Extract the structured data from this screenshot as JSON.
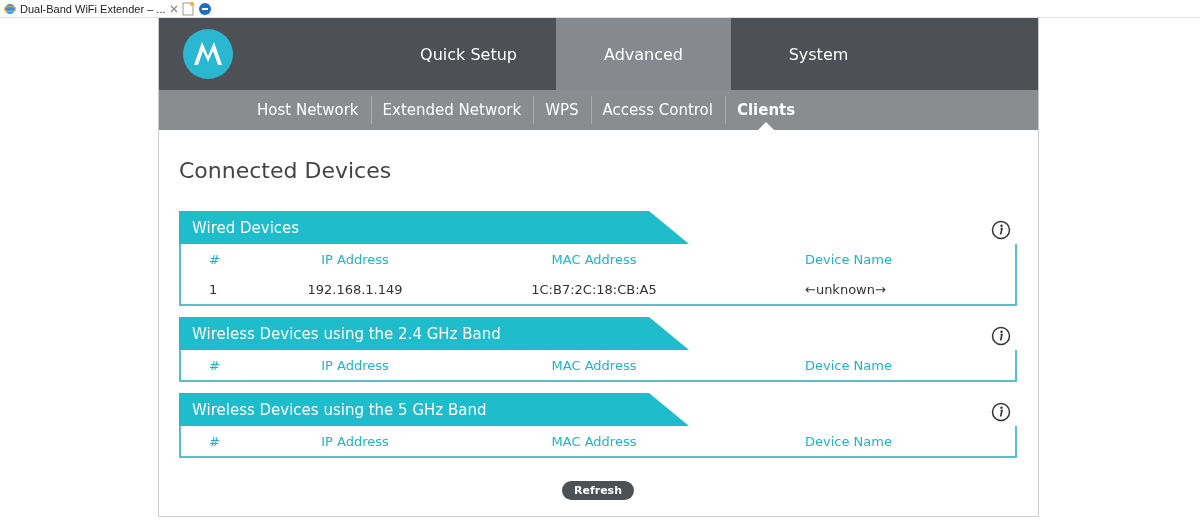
{
  "browser_tab": {
    "title": "Dual-Band WiFi Extender – ..."
  },
  "nav": {
    "tabs": [
      {
        "label": "Quick Setup",
        "selected": false
      },
      {
        "label": "Advanced",
        "selected": true
      },
      {
        "label": "System",
        "selected": false
      }
    ]
  },
  "subnav": {
    "items": [
      {
        "label": "Host Network",
        "selected": false
      },
      {
        "label": "Extended Network",
        "selected": false
      },
      {
        "label": "WPS",
        "selected": false
      },
      {
        "label": "Access Control",
        "selected": false
      },
      {
        "label": "Clients",
        "selected": true
      }
    ]
  },
  "page_title": "Connected Devices",
  "sections": [
    {
      "title": "Wired Devices",
      "columns": [
        "#",
        "IP Address",
        "MAC Address",
        "Device Name"
      ],
      "rows": [
        [
          "1",
          "192.168.1.149",
          "1C:B7:2C:18:CB:A5",
          "←unknown→"
        ]
      ]
    },
    {
      "title": "Wireless Devices using the 2.4 GHz Band",
      "columns": [
        "#",
        "IP Address",
        "MAC Address",
        "Device Name"
      ]
    },
    {
      "title": "Wireless Devices using the 5 GHz Band",
      "columns": [
        "#",
        "IP Address",
        "MAC Address",
        "Device Name"
      ]
    }
  ],
  "refresh_button": "Refresh"
}
